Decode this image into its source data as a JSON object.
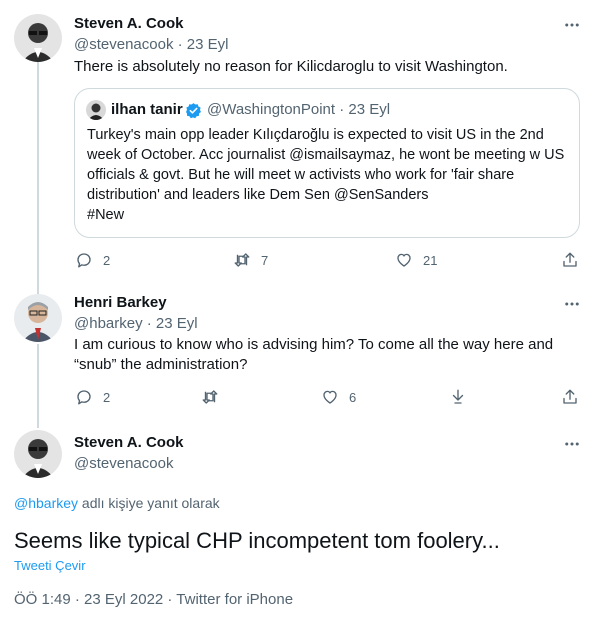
{
  "tweet1": {
    "name": "Steven A. Cook",
    "handle_date": "@stevenacook · 23 Eyl",
    "text": "There is absolutely no reason for Kilicdaroglu to visit Washington.",
    "quote": {
      "name": "ilhan tanir",
      "handle_date": "@WashingtonPoint · 23 Eyl",
      "text": "Turkey's main opp leader Kılıçdaroğlu is expected to visit US in the 2nd week of October. Acc journalist @ismailsaymaz, he wont be meeting w US officials & govt. But he will meet w activists who work for 'fair share distribution' and leaders like Dem Sen @SenSanders",
      "tag": "#New"
    },
    "actions": {
      "replies": "2",
      "retweets": "7",
      "likes": "21"
    }
  },
  "tweet2": {
    "name": "Henri Barkey",
    "handle_date": "@hbarkey · 23 Eyl",
    "text": "I am curious to know who is advising him? To come all the way here and “snub” the administration?",
    "actions": {
      "replies": "2",
      "likes": "6"
    }
  },
  "tweet3": {
    "name": "Steven A. Cook",
    "handle": "@stevenacook",
    "reply_to_handle": "@hbarkey",
    "reply_to_suffix": " adlı kişiye yanıt olarak",
    "text": "Seems like typical CHP incompetent tom foolery...",
    "translate": "Tweeti Çevir",
    "meta": "ÖÖ 1:49 · 23 Eyl 2022 · Twitter for iPhone"
  },
  "colors": {
    "accent": "#1d9bf0",
    "secondary_text": "#536471",
    "border": "#cfd9de"
  }
}
